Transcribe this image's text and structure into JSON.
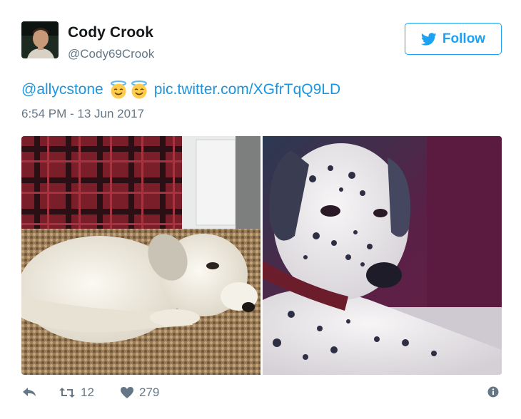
{
  "user": {
    "display_name": "Cody Crook",
    "handle": "@Cody69Crook"
  },
  "follow_button": {
    "label": "Follow"
  },
  "tweet": {
    "mention": "@allycstone",
    "emojis": [
      "smiling-face-with-halo",
      "smiling-face-with-halo"
    ],
    "link": "pic.twitter.com/XGfrTqQ9LD",
    "timestamp": "6:54 PM - 13 Jun 2017"
  },
  "media": [
    {
      "description_icon": "white-puppy-photo"
    },
    {
      "description_icon": "dalmatian-photo"
    }
  ],
  "actions": {
    "retweet_count": "12",
    "like_count": "279"
  },
  "colors": {
    "accent": "#1da1f2",
    "link": "#1b95e0",
    "muted": "#657786",
    "text": "#14171a"
  }
}
